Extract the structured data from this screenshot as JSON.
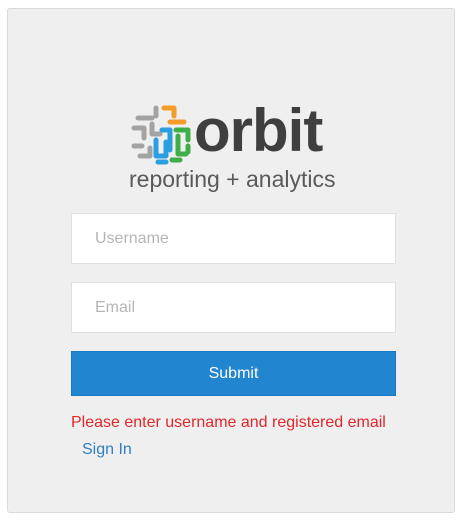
{
  "brand": {
    "name": "orbit",
    "tagline": "reporting + analytics",
    "colors": {
      "gray": "#9e9e9e",
      "orange": "#f39c2a",
      "blue": "#2a9ee0",
      "green": "#3fae49",
      "wordmark": "#3f3f3f"
    }
  },
  "form": {
    "username_placeholder": "Username",
    "username_value": "",
    "email_placeholder": "Email",
    "email_value": "",
    "submit_label": "Submit",
    "error_message": "Please enter username and registered email",
    "signin_link": "Sign In"
  },
  "colors": {
    "panel_bg": "#efefef",
    "button_bg": "#2185d0",
    "error": "#e0272b",
    "link": "#2f7fc1"
  }
}
